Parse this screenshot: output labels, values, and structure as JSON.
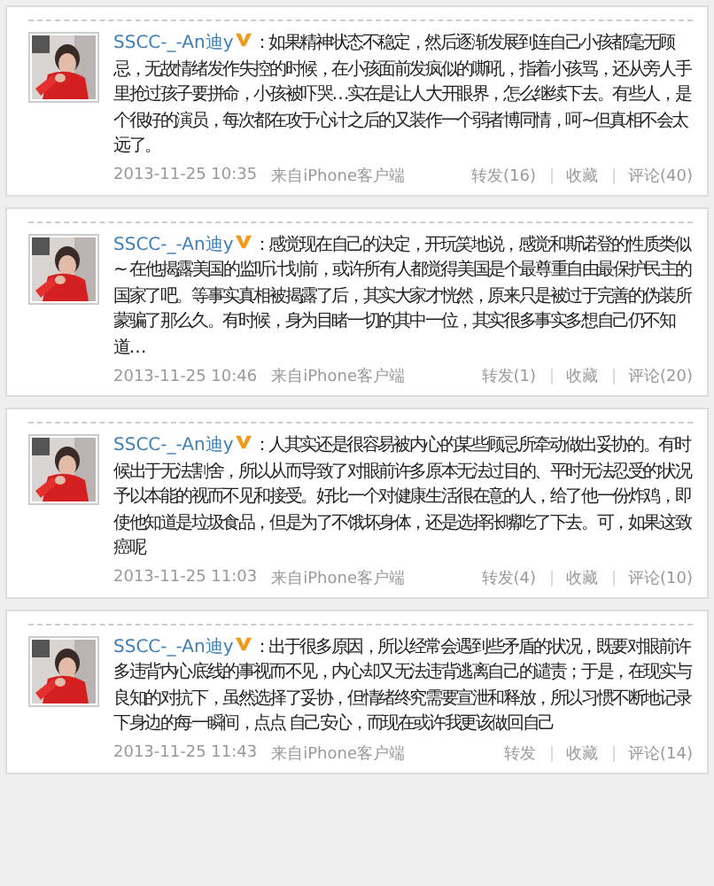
{
  "posts": [
    {
      "author": "SSCC-_-An迪y",
      "verified": true,
      "text": "：如果精神状态不稳定，然后逐渐发展到连自己小孩都毫无顾忌，无故情绪发作失控的时候，在小孩面前发疯似的嘶吼，指着小孩骂，还从旁人手里抢过孩子要拼命，小孩被吓哭…实在是让人大开眼界，怎么继续下去。有些人，是个很好的演员，每次都在攻于心计之后的又装作一个弱者博同情，呵~但真相不会太远了。",
      "time": "2013-11-25 10:35",
      "source": "来自iPhone客户端",
      "actions": [
        "转发(16)",
        "收藏",
        "评论(40)"
      ]
    },
    {
      "author": "SSCC-_-An迪y",
      "verified": true,
      "text": "：感觉现在自己的决定，开玩笑地说，感觉和斯诺登的性质类似~ 在他揭露美国的监听计划前，或许所有人都觉得美国是个最尊重自由最保护民主的国家了吧。等事实真相被揭露了后，其实大家才恍然，原来只是被过于完善的伪装所蒙骗了那么久。有时候，身为目睹一切的其中一位，其实很多事实多想自己仍不知道…",
      "time": "2013-11-25 10:46",
      "source": "来自iPhone客户端",
      "actions": [
        "转发(1)",
        "收藏",
        "评论(20)"
      ]
    },
    {
      "author": "SSCC-_-An迪y",
      "verified": true,
      "text": "：人其实还是很容易被内心的某些顾忌所牵动做出妥协的。有时候出于无法割舍，所以从而导致了对眼前许多原本无法过目的、平时无法忍受的状况予以本能的视而不见和接受。好比一个对健康生活很在意的人，给了他一份炸鸡，即使他知道是垃圾食品，但是为了不饿坏身体，还是选择张嘴吃了下去。可，如果这致癌呢",
      "time": "2013-11-25 11:03",
      "source": "来自iPhone客户端",
      "actions": [
        "转发(4)",
        "收藏",
        "评论(10)"
      ]
    },
    {
      "author": "SSCC-_-An迪y",
      "verified": true,
      "text": "：出于很多原因，所以经常会遇到些矛盾的状况，既要对眼前许多违背内心底线的事视而不见，内心却又无法违背逃离自己的谴责；于是，在现实与良知的对抗下，虽然选择了妥协，但情绪终究需要宣泄和释放，所以习惯不断地记录下身边的每一瞬间，点点 自己安心，而现在或许我更该做回自己",
      "time": "2013-11-25 11:43",
      "source": "来自iPhone客户端",
      "actions": [
        "转发",
        "收藏",
        "评论(14)"
      ]
    }
  ]
}
